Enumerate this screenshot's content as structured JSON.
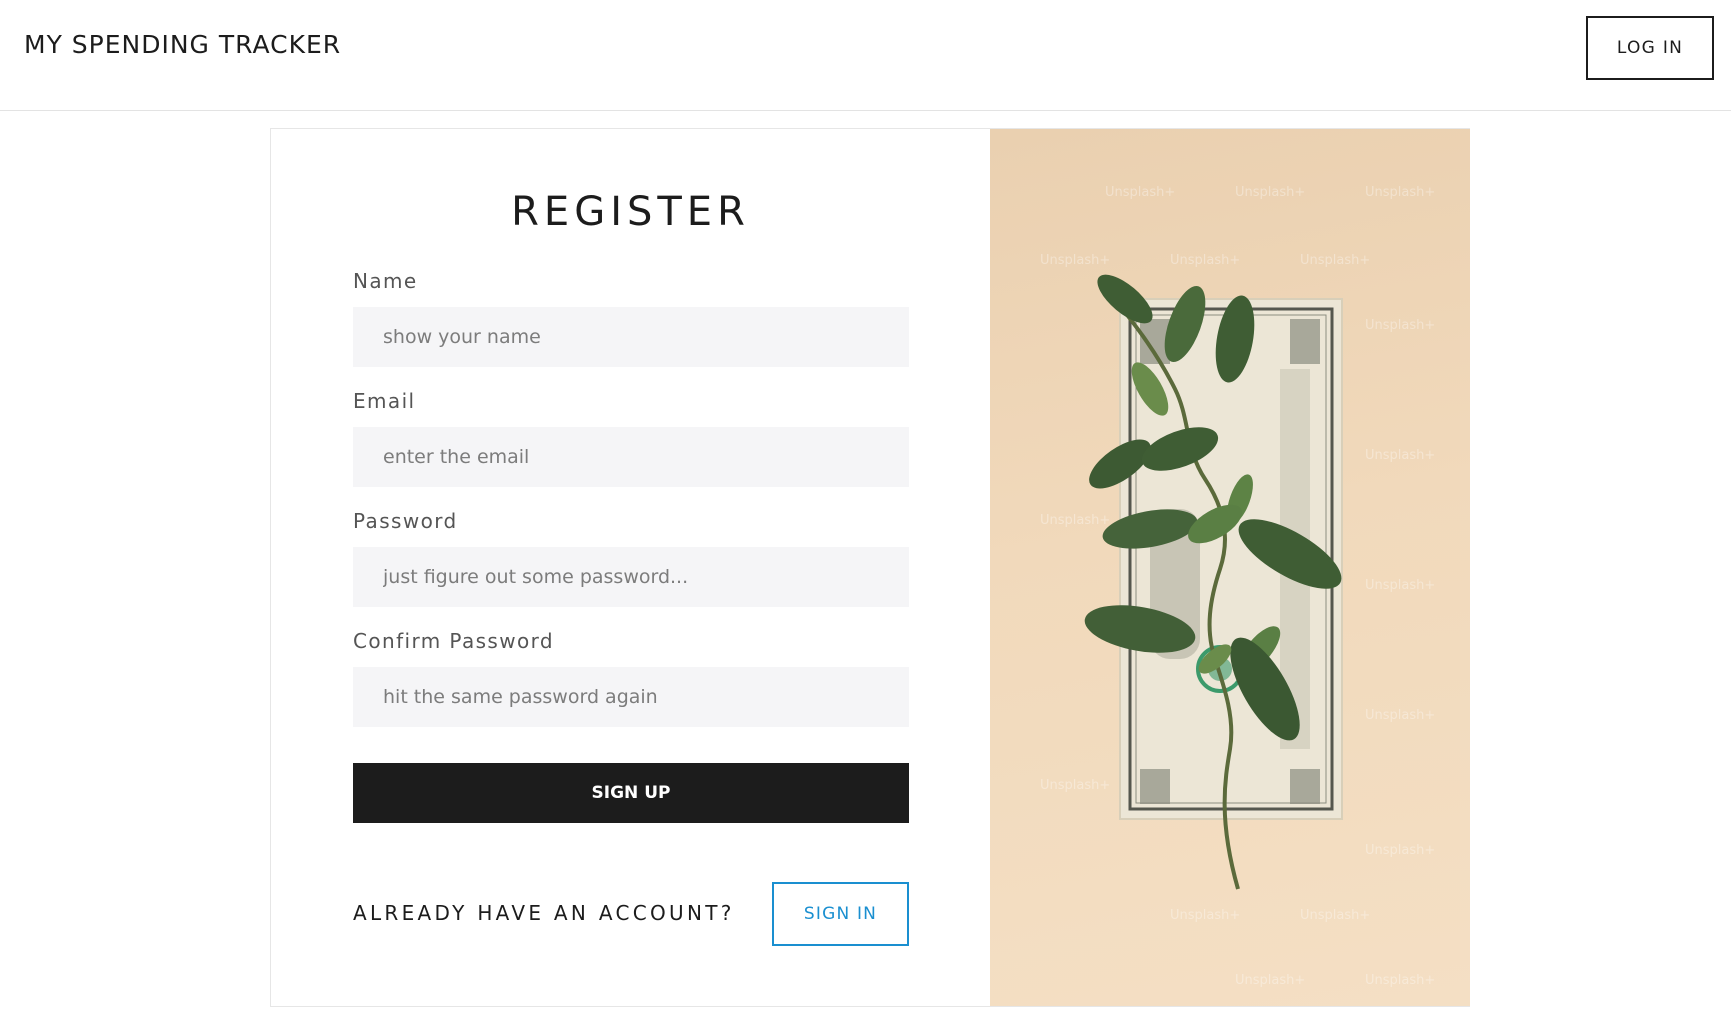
{
  "header": {
    "brand": "MY SPENDING TRACKER",
    "login_label": "LOG IN"
  },
  "form": {
    "title": "REGISTER",
    "fields": [
      {
        "label": "Name",
        "placeholder": "show your name"
      },
      {
        "label": "Email",
        "placeholder": "enter the email"
      },
      {
        "label": "Password",
        "placeholder": "just figure out some password..."
      },
      {
        "label": "Confirm Password",
        "placeholder": "hit the same password again"
      }
    ],
    "signup_label": "SIGN UP",
    "already_text": "ALREADY HAVE AN ACCOUNT?",
    "signin_label": "SIGN IN"
  },
  "image": {
    "watermark": "Unsplash+"
  },
  "colors": {
    "accent": "#1a8fd0",
    "primary_button": "#1c1c1c",
    "input_bg": "#f5f5f7",
    "image_bg": "#f1d9bb"
  }
}
